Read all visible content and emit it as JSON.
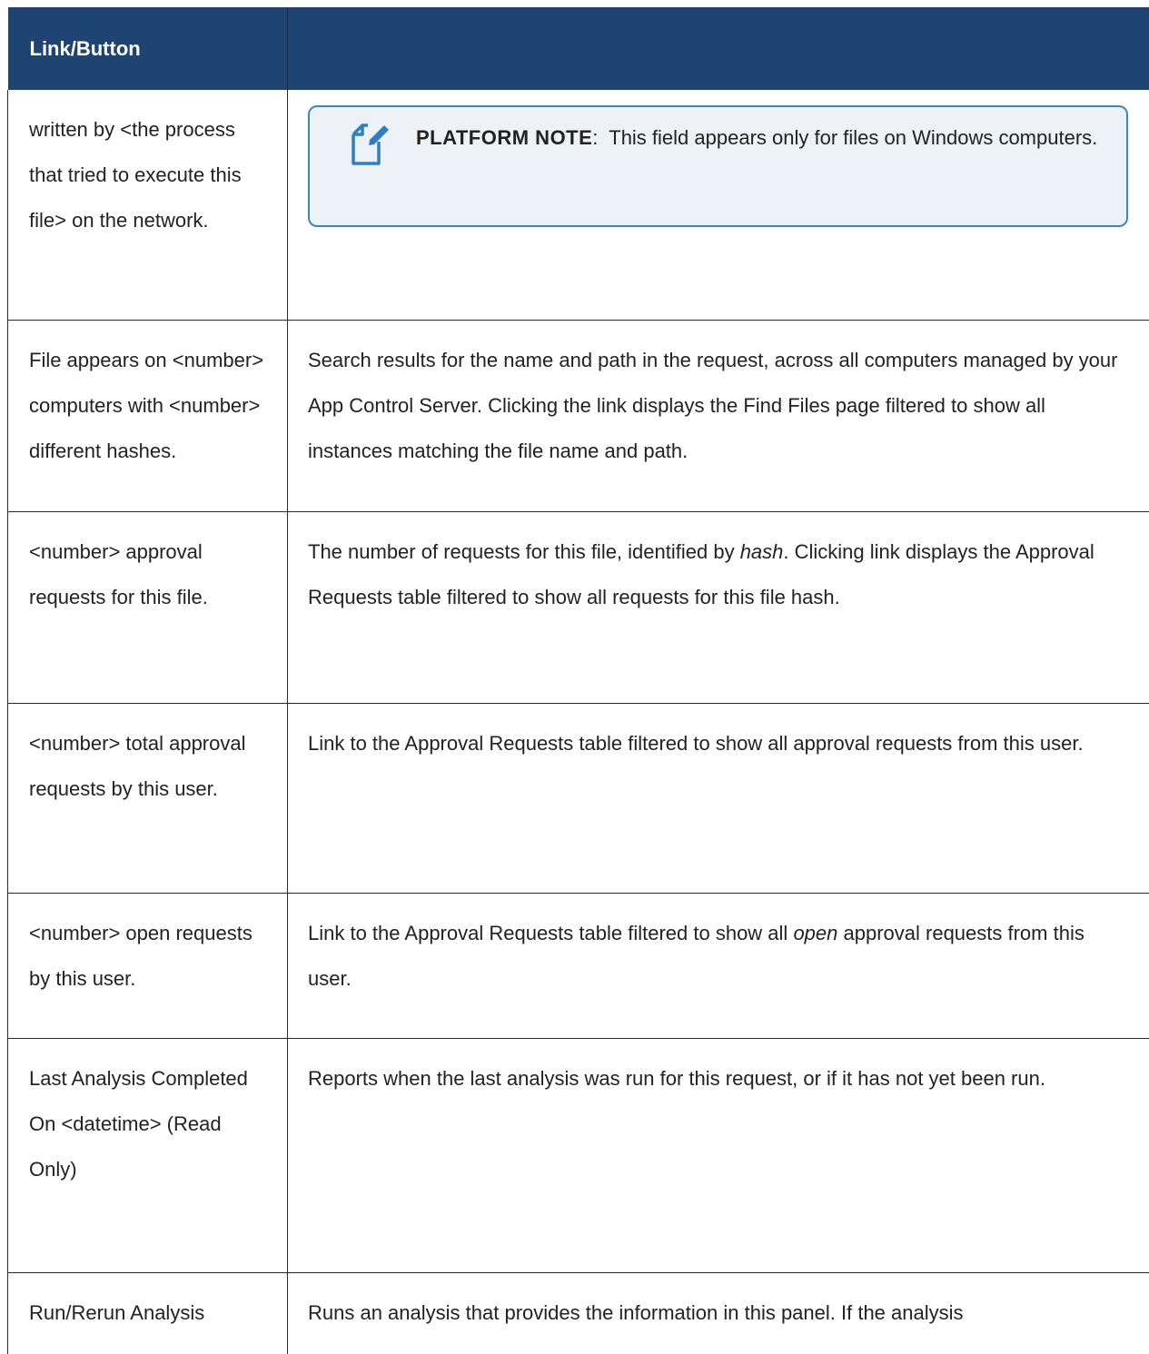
{
  "header": {
    "col1": "Link/Button",
    "col2": ""
  },
  "rows": [
    {
      "term": "written by <the process that tried to execute this file> on the network.",
      "note": {
        "icon": "note-edit-icon",
        "title": "PLATFORM NOTE",
        "separator": ":",
        "text": "This field appears only for files on Windows computers."
      }
    },
    {
      "term": "File appears on <number> computers with <number> different hashes.",
      "desc": "Search results for the name and path in the request, across all computers managed by your App Control Server. Clicking the link displays the Find Files page filtered to show all instances matching the file name and path."
    },
    {
      "term": "<number> approval requests for this file.",
      "desc_before": "The number of requests for this file, identified by ",
      "desc_em": "hash",
      "desc_after": ". Clicking link displays the Approval Requests table filtered to show all requests for this file hash."
    },
    {
      "term": "<number> total approval requests by this user.",
      "desc": "Link to the Approval Requests table filtered to show all approval requests from this user."
    },
    {
      "term": "<number> open requests by this user.",
      "desc_before": "Link to the Approval Requests table filtered to show all ",
      "desc_em": "open",
      "desc_after": " approval requests from this user."
    },
    {
      "term": "Last Analysis Completed On <datetime> (Read Only)",
      "desc": "Reports when the last analysis was run for this request, or if it has not yet been run."
    },
    {
      "term": "Run/Rerun Analysis",
      "desc": "Runs an analysis that provides the information in this panel. If the analysis"
    }
  ],
  "colors": {
    "header_bg": "#1f4372",
    "note_border": "#3a86c0",
    "note_bg": "#edf2f6",
    "icon": "#2e7fbf"
  }
}
